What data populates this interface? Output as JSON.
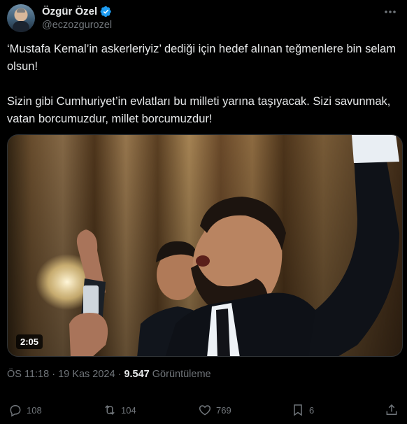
{
  "author": {
    "name": "Özgür Özel",
    "handle": "@eczozgurozel",
    "verified": true
  },
  "tweet": {
    "text": "‘Mustafa Kemal’in askerleriyiz’ dediği için hedef alınan teğmenlere bin selam olsun!\n\nSizin gibi Cumhuriyet’in evlatları bu milleti yarına taşıyacak. Sizi savunmak, vatan borcumuzdur, millet borcumuzdur!",
    "time": "ÖS 11:18",
    "separator": "·",
    "date": "19 Kas 2024",
    "views_count": "9.547",
    "views_label": "Görüntüleme"
  },
  "media": {
    "type": "video",
    "duration": "2:05"
  },
  "actions": {
    "replies": "108",
    "reposts": "104",
    "likes": "769",
    "bookmarks": "6"
  },
  "icons": {
    "more": "more-horizontal-icon",
    "verified": "verified-badge-icon",
    "reply": "reply-icon",
    "repost": "repost-icon",
    "like": "heart-icon",
    "bookmark": "bookmark-icon",
    "share": "share-icon"
  },
  "colors": {
    "background": "#000000",
    "text": "#e7e9ea",
    "secondary": "#71767b",
    "verified": "#1d9bf0"
  }
}
